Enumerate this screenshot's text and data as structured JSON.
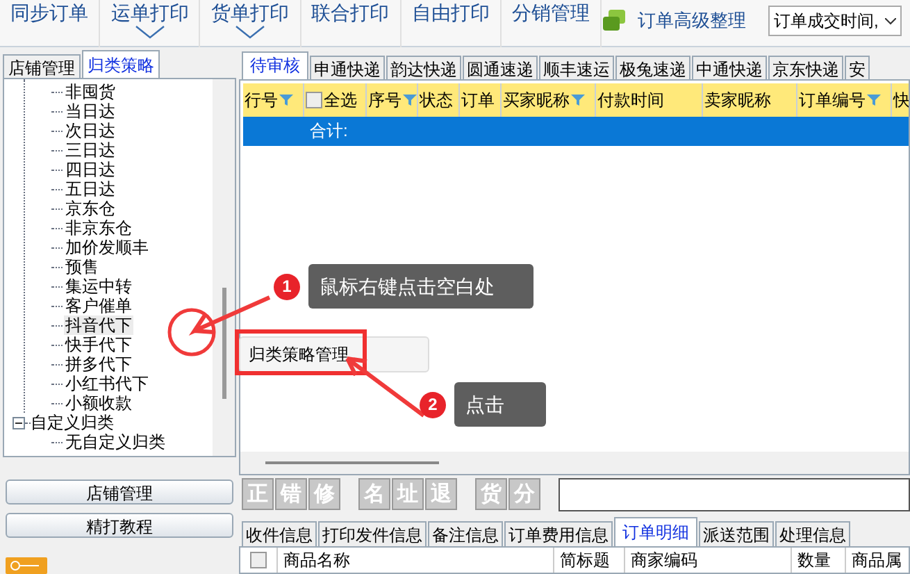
{
  "toolbar": {
    "items": [
      {
        "label": "同步订单",
        "dropdown": false
      },
      {
        "label": "运单打印",
        "dropdown": true
      },
      {
        "label": "货单打印",
        "dropdown": true
      },
      {
        "label": "联合打印",
        "dropdown": false
      },
      {
        "label": "自由打印",
        "dropdown": false
      },
      {
        "label": "分销管理",
        "dropdown": false
      }
    ],
    "organize_button": "订单高级整理",
    "sort_select": "订单成交时间,"
  },
  "left_tabs": [
    {
      "label": "店铺管理",
      "selected": false
    },
    {
      "label": "归类策略",
      "selected": true
    }
  ],
  "tree": [
    {
      "children": [
        {
          "label": "非囤货",
          "selected": false
        },
        {
          "label": "当日达",
          "selected": false
        },
        {
          "label": "次日达",
          "selected": false
        },
        {
          "label": "三日达",
          "selected": false
        },
        {
          "label": "四日达",
          "selected": false
        },
        {
          "label": "五日达",
          "selected": false
        },
        {
          "label": "京东仓",
          "selected": false
        },
        {
          "label": "非京东仓",
          "selected": false
        },
        {
          "label": "加价发顺丰",
          "selected": false
        },
        {
          "label": "预售",
          "selected": false
        },
        {
          "label": "集运中转",
          "selected": false
        },
        {
          "label": "客户催单",
          "selected": false
        },
        {
          "label": "抖音代下",
          "selected": true
        },
        {
          "label": "快手代下",
          "selected": false
        },
        {
          "label": "拼多代下",
          "selected": false
        },
        {
          "label": "小红书代下",
          "selected": false
        },
        {
          "label": "小额收款",
          "selected": false
        }
      ]
    },
    {
      "label": "自定义归类",
      "expanded": true,
      "selected": false,
      "children": [
        {
          "label": "无自定义归类",
          "selected": false
        }
      ]
    }
  ],
  "left_buttons": [
    "店铺管理",
    "精打教程"
  ],
  "courier_tabs": [
    {
      "label": "待审核",
      "selected": true
    },
    {
      "label": "申通快递",
      "selected": false
    },
    {
      "label": "韵达快递",
      "selected": false
    },
    {
      "label": "圆通速递",
      "selected": false
    },
    {
      "label": "顺丰速运",
      "selected": false
    },
    {
      "label": "极兔速递",
      "selected": false
    },
    {
      "label": "中通快递",
      "selected": false
    },
    {
      "label": "京东快递",
      "selected": false
    },
    {
      "label": "安",
      "selected": false
    }
  ],
  "order_table": {
    "columns": [
      {
        "label": "行号",
        "kind": "filter"
      },
      {
        "label": "全选",
        "kind": "checkbox",
        "checked": false
      },
      {
        "label": "序号",
        "kind": "filter"
      },
      {
        "label": "状态",
        "kind": "plain"
      },
      {
        "label": "订单",
        "kind": "plain"
      },
      {
        "label": "买家昵称",
        "kind": "filter"
      },
      {
        "label": "付款时间",
        "kind": "plain"
      },
      {
        "label": "卖家昵称",
        "kind": "plain"
      },
      {
        "label": "订单编号",
        "kind": "filter"
      },
      {
        "label": "快",
        "kind": "plain"
      }
    ],
    "total_label": "合计:"
  },
  "context_menu": {
    "items": [
      "归类策略管理"
    ]
  },
  "callouts": [
    {
      "number": "1",
      "text": "鼠标右键点击空白处"
    },
    {
      "number": "2",
      "text": "点击"
    }
  ],
  "action_buttons": [
    [
      "正",
      "错",
      "修"
    ],
    [
      "名",
      "址",
      "退"
    ],
    [
      "货",
      "分"
    ]
  ],
  "detail_tabs": [
    {
      "label": "收件信息",
      "selected": false
    },
    {
      "label": "打印发件信息",
      "selected": false
    },
    {
      "label": "备注信息",
      "selected": false
    },
    {
      "label": "订单费用信息",
      "selected": false
    },
    {
      "label": "订单明细",
      "selected": true
    },
    {
      "label": "派送范围",
      "selected": false
    },
    {
      "label": "处理信息",
      "selected": false
    }
  ],
  "detail_table": {
    "checked": false,
    "columns": [
      "商品名称",
      "简标题",
      "商家编码",
      "数量",
      "商品属"
    ]
  }
}
